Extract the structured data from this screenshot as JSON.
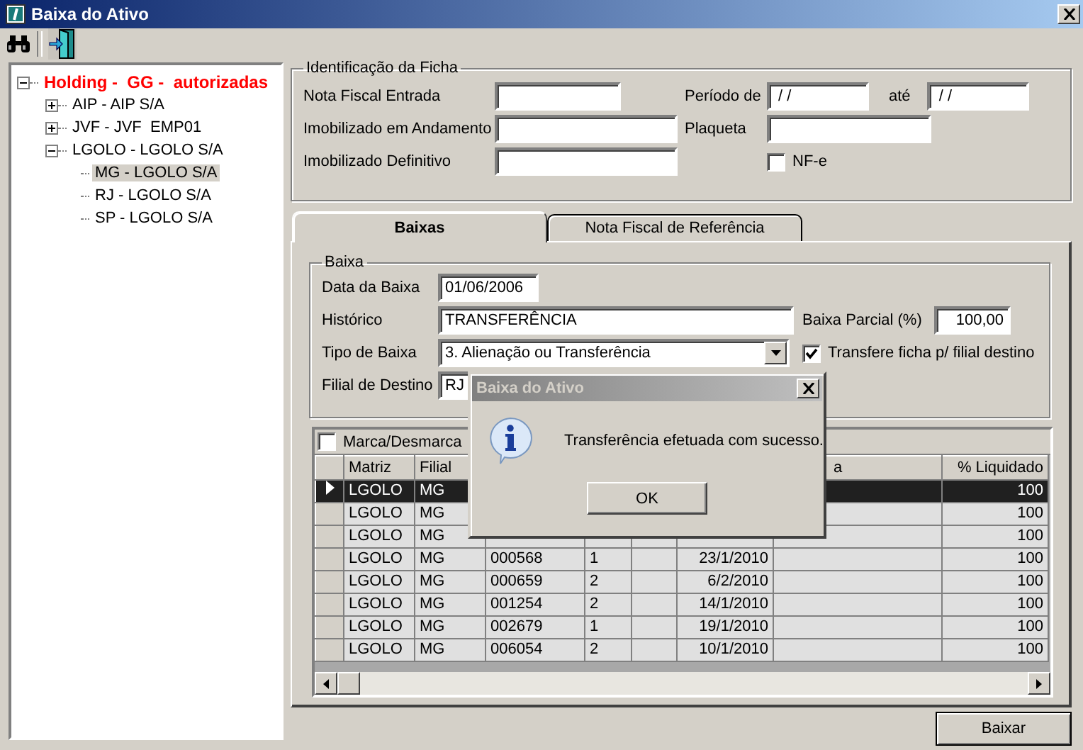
{
  "window": {
    "title": "Baixa do Ativo"
  },
  "tree": {
    "label": "Holding -  GG -  autorizadas",
    "expanded": true,
    "selected": false,
    "children": [
      {
        "label": "AIP - AIP S/A",
        "expanded": false,
        "selected": false
      },
      {
        "label": "JVF - JVF  EMP01",
        "expanded": false,
        "selected": false
      },
      {
        "label": "LGOLO - LGOLO S/A",
        "expanded": true,
        "selected": false,
        "children": [
          {
            "label": "MG - LGOLO S/A",
            "selected": true
          },
          {
            "label": "RJ - LGOLO S/A",
            "selected": false
          },
          {
            "label": "SP - LGOLO S/A",
            "selected": false
          }
        ]
      }
    ]
  },
  "identificacao": {
    "title": "Identificação da Ficha",
    "nota_fiscal_entrada": "Nota Fiscal Entrada",
    "imobilizado_andamento": "Imobilizado em Andamento",
    "imobilizado_definitivo": "Imobilizado Definitivo",
    "periodo_de": {
      "label": "Período de",
      "value": " / /"
    },
    "ate": {
      "label": "até",
      "value": " / /"
    },
    "plaqueta": "Plaqueta",
    "nfe": {
      "label": "NF-e",
      "checked": false
    }
  },
  "tabs": [
    {
      "label": "Baixas",
      "selected": true
    },
    {
      "label": "Nota Fiscal de Referência",
      "selected": false
    }
  ],
  "baixa": {
    "title": "Baixa",
    "data": {
      "label": "Data da Baixa",
      "value": "01/06/2006"
    },
    "historico": {
      "label": "Histórico",
      "value": "TRANSFERÊNCIA"
    },
    "parcial": {
      "label": "Baixa Parcial (%)",
      "value": "100,00"
    },
    "tipo": {
      "label": "Tipo de Baixa",
      "value": "3. Alienação ou Transferência"
    },
    "transfere": {
      "label": "Transfere ficha p/ filial destino",
      "checked": true
    },
    "filial": {
      "label": "Filial de Destino",
      "value": "RJ"
    }
  },
  "grid": {
    "mark_all": {
      "label": "Marca/Desmarca",
      "checked": false
    },
    "columns": [
      {
        "label": "Matriz"
      },
      {
        "label": "Filial"
      },
      {},
      {},
      {},
      {},
      {
        "label": "a"
      },
      {
        "label": "% Liquidado"
      }
    ],
    "rows": [
      {
        "selected": true,
        "cells": [
          "LGOLO",
          "MG",
          null,
          null,
          null,
          null,
          null,
          "100"
        ]
      },
      {
        "selected": false,
        "cells": [
          "LGOLO",
          "MG",
          null,
          null,
          null,
          null,
          null,
          "100"
        ]
      },
      {
        "selected": false,
        "cells": [
          "LGOLO",
          "MG",
          null,
          null,
          null,
          null,
          null,
          "100"
        ]
      },
      {
        "selected": false,
        "cells": [
          "LGOLO",
          "MG",
          "000568",
          "1",
          null,
          "23/1/2010",
          null,
          "100"
        ]
      },
      {
        "selected": false,
        "cells": [
          "LGOLO",
          "MG",
          "000659",
          "2",
          null,
          "6/2/2010",
          null,
          "100"
        ]
      },
      {
        "selected": false,
        "cells": [
          "LGOLO",
          "MG",
          "001254",
          "2",
          null,
          "14/1/2010",
          null,
          "100"
        ]
      },
      {
        "selected": false,
        "cells": [
          "LGOLO",
          "MG",
          "002679",
          "1",
          null,
          "19/1/2010",
          null,
          "100"
        ]
      },
      {
        "selected": false,
        "cells": [
          "LGOLO",
          "MG",
          "006054",
          "2",
          null,
          "10/1/2010",
          null,
          "100"
        ]
      }
    ]
  },
  "action_button": "Baixar",
  "dialog": {
    "title": "Baixa do Ativo",
    "message": "Transferência efetuada com sucesso.",
    "button": "OK"
  }
}
